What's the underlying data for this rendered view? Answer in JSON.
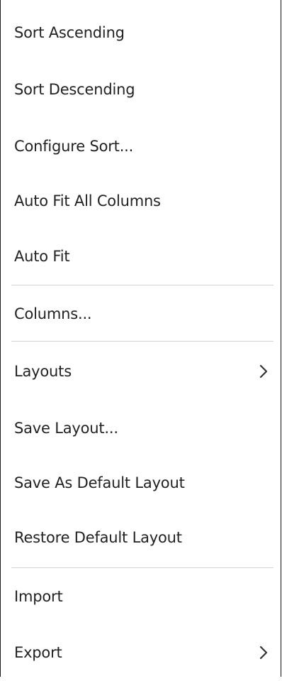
{
  "menu": {
    "items": [
      {
        "label": "Sort Ascending"
      },
      {
        "label": "Sort Descending"
      },
      {
        "label": "Configure Sort..."
      },
      {
        "label": "Auto Fit All Columns"
      },
      {
        "label": "Auto Fit"
      },
      {
        "label": "Columns..."
      },
      {
        "label": "Layouts",
        "icon": "chevron-right-icon"
      },
      {
        "label": "Save Layout..."
      },
      {
        "label": "Save As Default Layout"
      },
      {
        "label": "Restore Default Layout"
      },
      {
        "label": "Import"
      },
      {
        "label": "Export",
        "icon": "chevron-right-icon"
      }
    ]
  },
  "colors": {
    "text": "#222222",
    "separator": "#d2d2d2",
    "border": "#1a1a1a",
    "background": "#ffffff"
  }
}
